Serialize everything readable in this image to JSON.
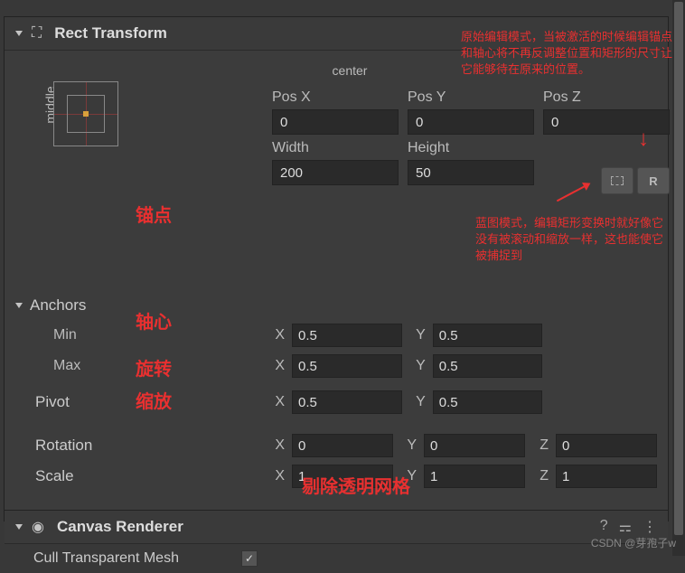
{
  "rect": {
    "title": "Rect Transform",
    "anchorPreset": {
      "top": "center",
      "side": "middle"
    },
    "posX": {
      "label": "Pos X",
      "value": "0"
    },
    "posY": {
      "label": "Pos Y",
      "value": "0"
    },
    "posZ": {
      "label": "Pos Z",
      "value": "0"
    },
    "width": {
      "label": "Width",
      "value": "200"
    },
    "height": {
      "label": "Height",
      "value": "50"
    },
    "modeR": "R",
    "anchorsLabel": "Anchors",
    "minLabel": "Min",
    "maxLabel": "Max",
    "pivotLabel": "Pivot",
    "rotationLabel": "Rotation",
    "scaleLabel": "Scale",
    "min": {
      "x": "0.5",
      "y": "0.5"
    },
    "max": {
      "x": "0.5",
      "y": "0.5"
    },
    "pivot": {
      "x": "0.5",
      "y": "0.5"
    },
    "rotation": {
      "x": "0",
      "y": "0",
      "z": "0"
    },
    "scale": {
      "x": "1",
      "y": "1",
      "z": "1"
    },
    "xLabel": "X",
    "yLabel": "Y",
    "zLabel": "Z"
  },
  "canvas": {
    "title": "Canvas Renderer",
    "cullLabel": "Cull Transparent Mesh",
    "cullChecked": "✓"
  },
  "annotations": {
    "anchor": "锚点",
    "pivot": "轴心",
    "rotation": "旋转",
    "scale": "缩放",
    "cull": "剔除透明网格",
    "rawMode": "原始编辑模式，当被激活的时候编辑锚点和轴心将不再反调整位置和矩形的尺寸让它能够待在原来的位置。",
    "blueprintMode": "蓝图模式，编辑矩形变换时就好像它没有被滚动和缩放一样，这也能使它被捕捉到"
  },
  "watermark": "CSDN @芽孢子w"
}
